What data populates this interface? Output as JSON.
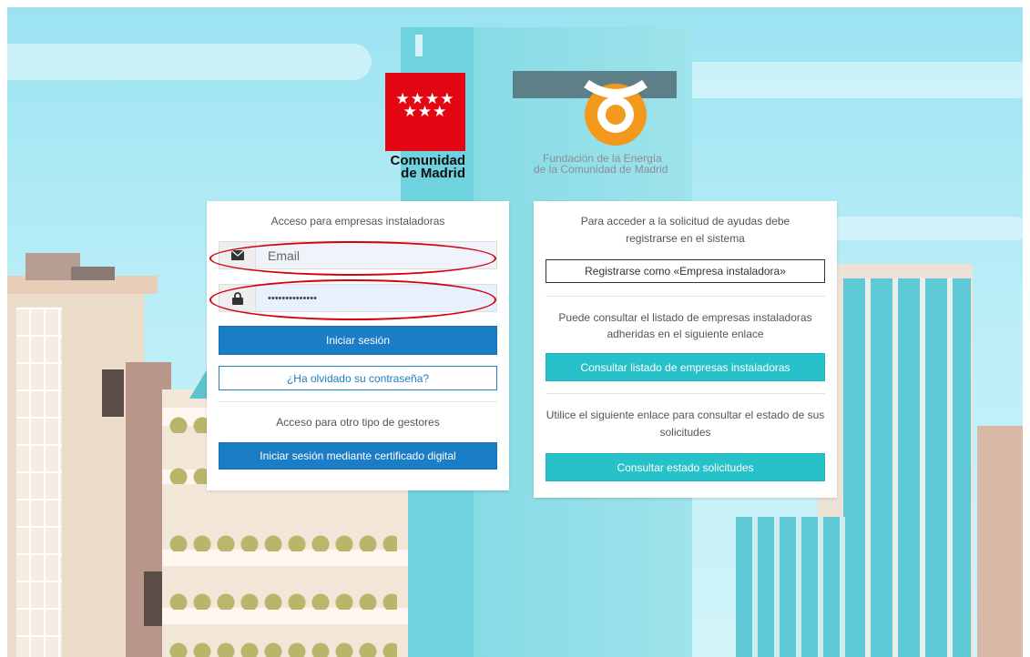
{
  "logos": {
    "comunidad_stars": "★★★★\n★★★",
    "comunidad_line1": "Comunidad",
    "comunidad_line2": "de Madrid",
    "fundacion_line1": "Fundación de la Energía",
    "fundacion_line2": "de la Comunidad de Madrid",
    "comunidad_color": "#e30613",
    "fundacion_color": "#f39a1e"
  },
  "login_panel": {
    "title": "Acceso para empresas instaladoras",
    "email": {
      "placeholder": "Email",
      "icon": "envelope-icon"
    },
    "password": {
      "value": "••••••••••••••",
      "icon": "lock-icon"
    },
    "login_button": "Iniciar sesión",
    "forgot_button": "¿Ha olvidado su contraseña?",
    "other_title": "Acceso para otro tipo de gestores",
    "certificate_button": "Iniciar sesión mediante certificado digital"
  },
  "info_panel": {
    "register_text": "Para acceder a la solicitud de ayudas debe registrarse en el sistema",
    "register_button": "Registrarse como «Empresa instaladora»",
    "list_text": "Puede consultar el listado de empresas instaladoras adheridas en el siguiente enlace",
    "list_button": "Consultar listado de empresas instaladoras",
    "status_text": "Utilice el siguiente enlace para consultar el estado de sus solicitudes",
    "status_button": "Consultar estado solicitudes"
  },
  "colors": {
    "primary_blue": "#1b7dc5",
    "teal": "#27c2c9",
    "annotation_red": "#d7000f"
  }
}
